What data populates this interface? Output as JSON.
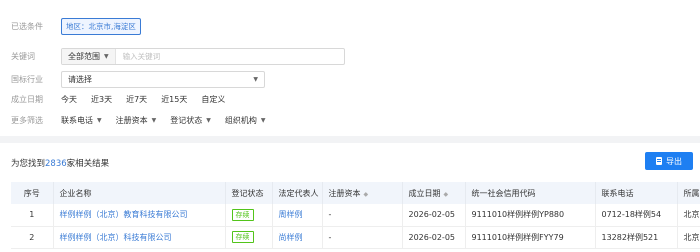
{
  "filters": {
    "selected_label": "已选条件",
    "selected_tag": "地区：北京市,海淀区",
    "keyword_label": "关键词",
    "keyword_scope": "全部范围",
    "keyword_placeholder": "输入关键词",
    "industry_label": "国标行业",
    "industry_value": "请选择",
    "date_label": "成立日期",
    "date_options": [
      "今天",
      "近3天",
      "近7天",
      "近15天",
      "自定义"
    ],
    "more_label": "更多筛选",
    "more_options": [
      "联系电话",
      "注册资本",
      "登记状态",
      "组织机构"
    ]
  },
  "results": {
    "summary_prefix": "为您找到",
    "count": "2836",
    "summary_suffix": "家相关结果",
    "export_label": "导出"
  },
  "table": {
    "headers": [
      "序号",
      "企业名称",
      "登记状态",
      "法定代表人",
      "注册资本",
      "成立日期",
      "统一社会信用代码",
      "联系电话",
      "所属"
    ],
    "rows": [
      [
        "1",
        "样例样例（北京）教育科技有限公司",
        "存续",
        "周样例",
        "-",
        "2026-02-05",
        "9111010样例样例YP880",
        "0712-18样例54",
        "北京"
      ],
      [
        "2",
        "样例样例（北京）科技有限公司",
        "存续",
        "尚样例",
        "-",
        "2026-02-05",
        "9111010样例样例FYY79",
        "13282样例521",
        "北京"
      ]
    ]
  }
}
